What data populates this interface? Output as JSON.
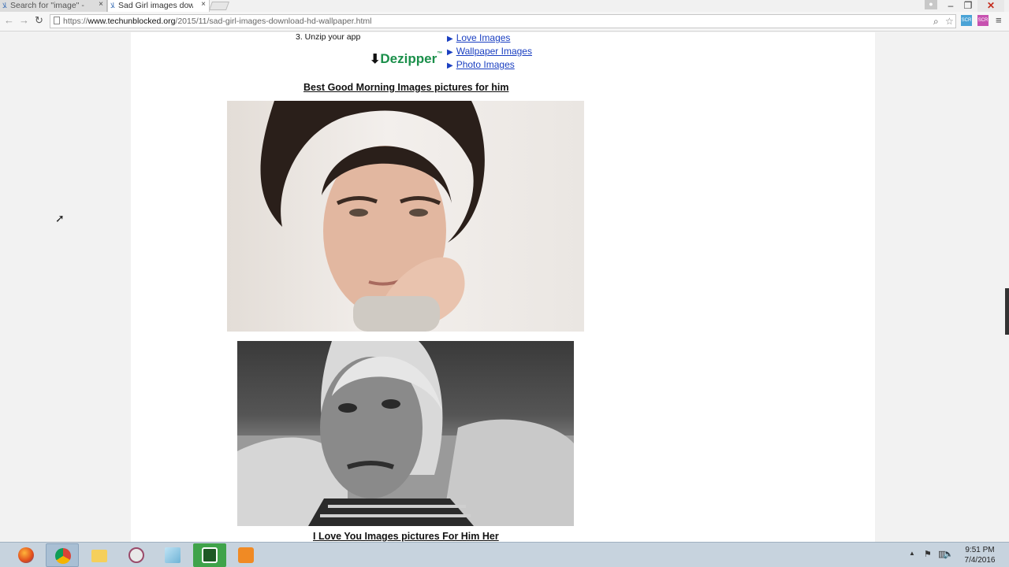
{
  "browser": {
    "tabs": [
      {
        "title": "Search for \"image\" -",
        "active": false
      },
      {
        "title": "Sad Girl images dow",
        "active": true
      }
    ],
    "url_prefix": "https://",
    "url_host": "www.techunblocked.org",
    "url_path": "/2015/11/sad-girl-images-download-hd-wallpaper.html"
  },
  "page": {
    "step_text": "3. Unzip your app",
    "ad_brand": "Dezipper",
    "related_links": [
      "Love Images",
      "Wallpaper Images",
      "Photo Images"
    ],
    "caption_1": "Best Good Morning Images pictures for him",
    "caption_2": "I Love You Images pictures For Him Her"
  },
  "taskbar": {
    "time": "9:51 PM",
    "date": "7/4/2016",
    "apps": [
      "firefox-icon",
      "chrome-icon",
      "file-explorer-icon",
      "paint-icon",
      "notepad-icon",
      "camtasia-icon",
      "media-player-icon"
    ]
  },
  "colors": {
    "link": "#1a3fc1",
    "dezipper_green": "#1a8f4a"
  }
}
